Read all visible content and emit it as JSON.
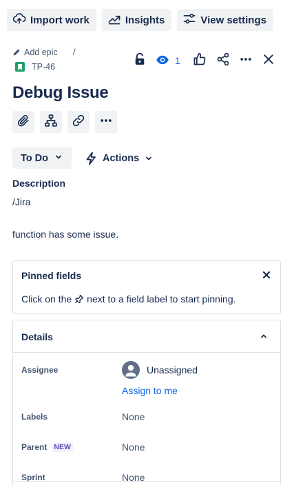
{
  "toolbar": {
    "import_label": "Import work",
    "insights_label": "Insights",
    "view_settings_label": "View settings"
  },
  "breadcrumb": {
    "add_epic_label": "Add epic",
    "separator": "/",
    "issue_key": "TP-46"
  },
  "header_actions": {
    "watchers_count": "1"
  },
  "issue": {
    "title": "Debug Issue",
    "status_label": "To Do",
    "actions_label": "Actions"
  },
  "description": {
    "label": "Description",
    "line1": "/Jira",
    "line2": "function has some issue."
  },
  "pinned_fields": {
    "title": "Pinned fields",
    "text_before": "Click on the",
    "text_after": "next to a field label to start pinning."
  },
  "details": {
    "title": "Details",
    "assignee_label": "Assignee",
    "assignee_value": "Unassigned",
    "assign_to_me": "Assign to me",
    "labels_label": "Labels",
    "labels_value": "None",
    "parent_label": "Parent",
    "parent_badge": "NEW",
    "parent_value": "None",
    "sprint_label": "Sprint",
    "sprint_value": "None"
  },
  "colors": {
    "text": "#172b4d",
    "subtle_text": "#44546f",
    "link": "#0c66e4",
    "button_bg": "#f1f2f4",
    "border": "#dcdfe4",
    "story_green": "#22a06b",
    "new_badge_text": "#5e4db2"
  },
  "icons": [
    "cloud-upload-icon",
    "insights-chart-icon",
    "sliders-icon",
    "pencil-icon",
    "story-icon",
    "unlock-icon",
    "eye-icon",
    "thumbs-up-icon",
    "share-icon",
    "more-icon",
    "close-icon",
    "paperclip-icon",
    "hierarchy-icon",
    "link-icon",
    "chevron-down-icon",
    "lightning-icon",
    "pin-icon",
    "chevron-up-icon",
    "avatar-icon"
  ]
}
